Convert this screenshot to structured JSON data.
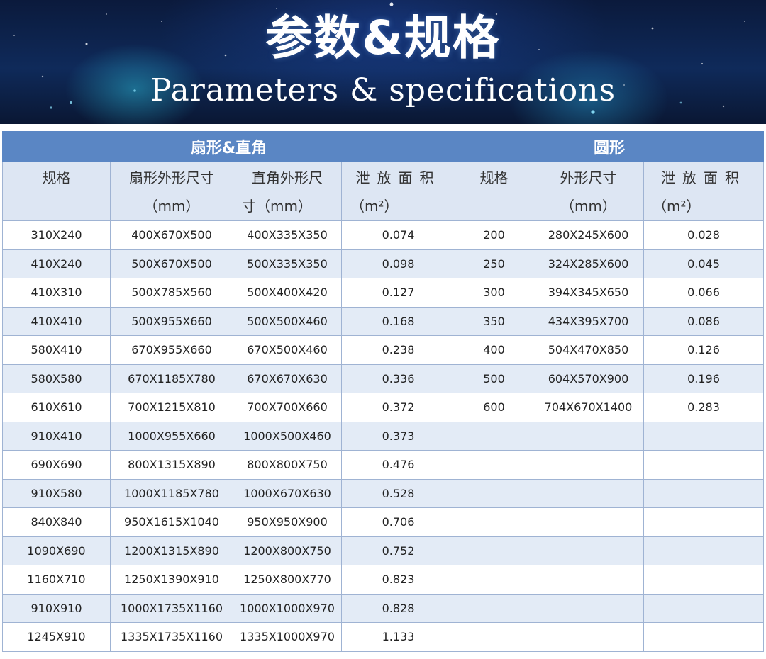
{
  "banner": {
    "title": "参数&规格",
    "subtitle": "Parameters & specifications"
  },
  "table": {
    "group_left": "扇形&直角",
    "group_right": "圆形",
    "headers": {
      "c1": "规格",
      "c2_line1": "扇形外形尺寸",
      "c2_line2": "（mm）",
      "c3_line1": "直角外形尺",
      "c3_line2": "寸（mm）",
      "c4_line1": "泄放面积",
      "c4_line2": "（m²）",
      "c5": "规格",
      "c6_line1": "外形尺寸",
      "c6_line2": "（mm）",
      "c7_line1": "泄放面积",
      "c7_line2": "（m²）"
    },
    "rows": [
      [
        "310X240",
        "400X670X500",
        "400X335X350",
        "0.074",
        "200",
        "280X245X600",
        "0.028"
      ],
      [
        "410X240",
        "500X670X500",
        "500X335X350",
        "0.098",
        "250",
        "324X285X600",
        "0.045"
      ],
      [
        "410X310",
        "500X785X560",
        "500X400X420",
        "0.127",
        "300",
        "394X345X650",
        "0.066"
      ],
      [
        "410X410",
        "500X955X660",
        "500X500X460",
        "0.168",
        "350",
        "434X395X700",
        "0.086"
      ],
      [
        "580X410",
        "670X955X660",
        "670X500X460",
        "0.238",
        "400",
        "504X470X850",
        "0.126"
      ],
      [
        "580X580",
        "670X1185X780",
        "670X670X630",
        "0.336",
        "500",
        "604X570X900",
        "0.196"
      ],
      [
        "610X610",
        "700X1215X810",
        "700X700X660",
        "0.372",
        "600",
        "704X670X1400",
        "0.283"
      ],
      [
        "910X410",
        "1000X955X660",
        "1000X500X460",
        "0.373",
        "",
        "",
        ""
      ],
      [
        "690X690",
        "800X1315X890",
        "800X800X750",
        "0.476",
        "",
        "",
        ""
      ],
      [
        "910X580",
        "1000X1185X780",
        "1000X670X630",
        "0.528",
        "",
        "",
        ""
      ],
      [
        "840X840",
        "950X1615X1040",
        "950X950X900",
        "0.706",
        "",
        "",
        ""
      ],
      [
        "1090X690",
        "1200X1315X890",
        "1200X800X750",
        "0.752",
        "",
        "",
        ""
      ],
      [
        "1160X710",
        "1250X1390X910",
        "1250X800X770",
        "0.823",
        "",
        "",
        ""
      ],
      [
        "910X910",
        "1000X1735X1160",
        "1000X1000X970",
        "0.828",
        "",
        "",
        ""
      ],
      [
        "1245X910",
        "1335X1735X1160",
        "1335X1000X970",
        "1.133",
        "",
        "",
        ""
      ]
    ]
  },
  "colors": {
    "group_header": "#5a86c4",
    "column_header": "#dde6f3",
    "row_alt": "#e3ebf6",
    "border": "#9fb3d3"
  }
}
